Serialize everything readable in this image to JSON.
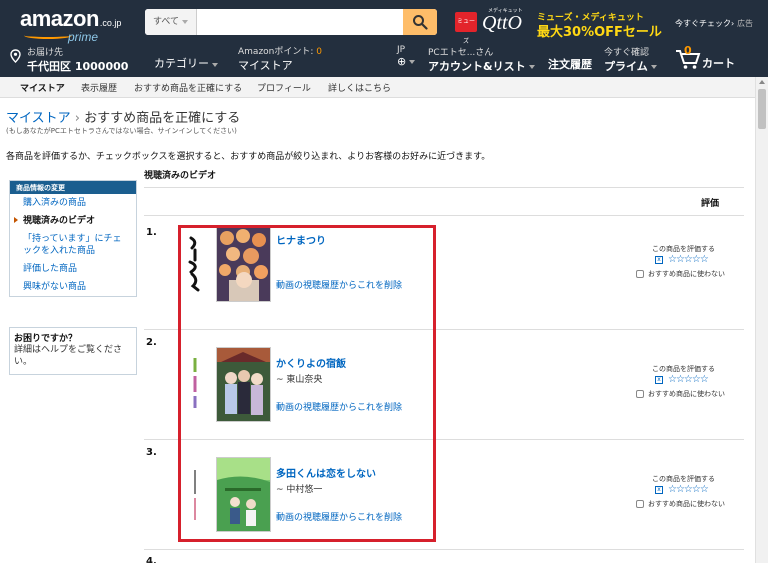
{
  "header": {
    "logo_main": "amazon",
    "logo_cojp": ".co.jp",
    "logo_prime": "prime",
    "search_category": "すべて",
    "search_value": "",
    "promo_badge": "ミューズ",
    "promo_logo_small": "メディキュット",
    "promo_logo": "QttO",
    "promo_line1": "ミューズ・メディキュット",
    "promo_line2": "最大30%OFFセール",
    "check_now": "今すぐチェック›",
    "ad_label": "広告",
    "deliver_to_small": "お届け先",
    "deliver_to": "千代田区 1000000",
    "category": "カテゴリー",
    "points_label": "Amazonポイント:",
    "points_value": "0",
    "mystore": "マイストア",
    "lang": "JP",
    "account_small": "PCエトセ...さん",
    "account": "アカウント&リスト",
    "orders": "注文履歴",
    "prime_small": "今すぐ確認",
    "prime": "プライム",
    "cart_count": "0",
    "cart": "カート"
  },
  "subnav": [
    "マイストア",
    "表示履歴",
    "おすすめ商品を正確にする",
    "プロフィール",
    "詳しくはこちら"
  ],
  "breadcrumb": {
    "root": "マイストア",
    "sep": "›",
    "current": "おすすめ商品を正確にする",
    "note": "(もしあなたがPCエトセトラさんではない場合、サインインしてください)"
  },
  "intro": "各商品を評価するか、チェックボックスを選択すると、おすすめ商品が絞り込まれ、よりお客様のお好みに近づきます。",
  "sidebar": {
    "heading": "商品情報の変更",
    "items": [
      "購入済みの商品",
      "視聴済みのビデオ",
      "「持っています」にチェックを入れた商品",
      "評価した商品",
      "興味がない商品"
    ],
    "help_title": "お困りですか？",
    "help_text": "詳細はヘルプをご覧ください。"
  },
  "main": {
    "section_title": "視聴済みのビデオ",
    "eval_header": "評価",
    "items": [
      {
        "num": "1.",
        "title": "ヒナまつり",
        "author": "",
        "remove": "動画の視聴履歴からこれを削除",
        "rate_label": "この商品を評価する",
        "stars": "☆☆☆☆☆",
        "nouse": "おすすめ商品に使わない"
      },
      {
        "num": "2.",
        "title": "かくりよの宿飯",
        "author": "~ 東山奈央",
        "remove": "動画の視聴履歴からこれを削除",
        "rate_label": "この商品を評価する",
        "stars": "☆☆☆☆☆",
        "nouse": "おすすめ商品に使わない"
      },
      {
        "num": "3.",
        "title": "多田くんは恋をしない",
        "author": "~ 中村悠一",
        "remove": "動画の視聴履歴からこれを削除",
        "rate_label": "この商品を評価する",
        "stars": "☆☆☆☆☆",
        "nouse": "おすすめ商品に使わない"
      }
    ],
    "next_num": "4."
  }
}
